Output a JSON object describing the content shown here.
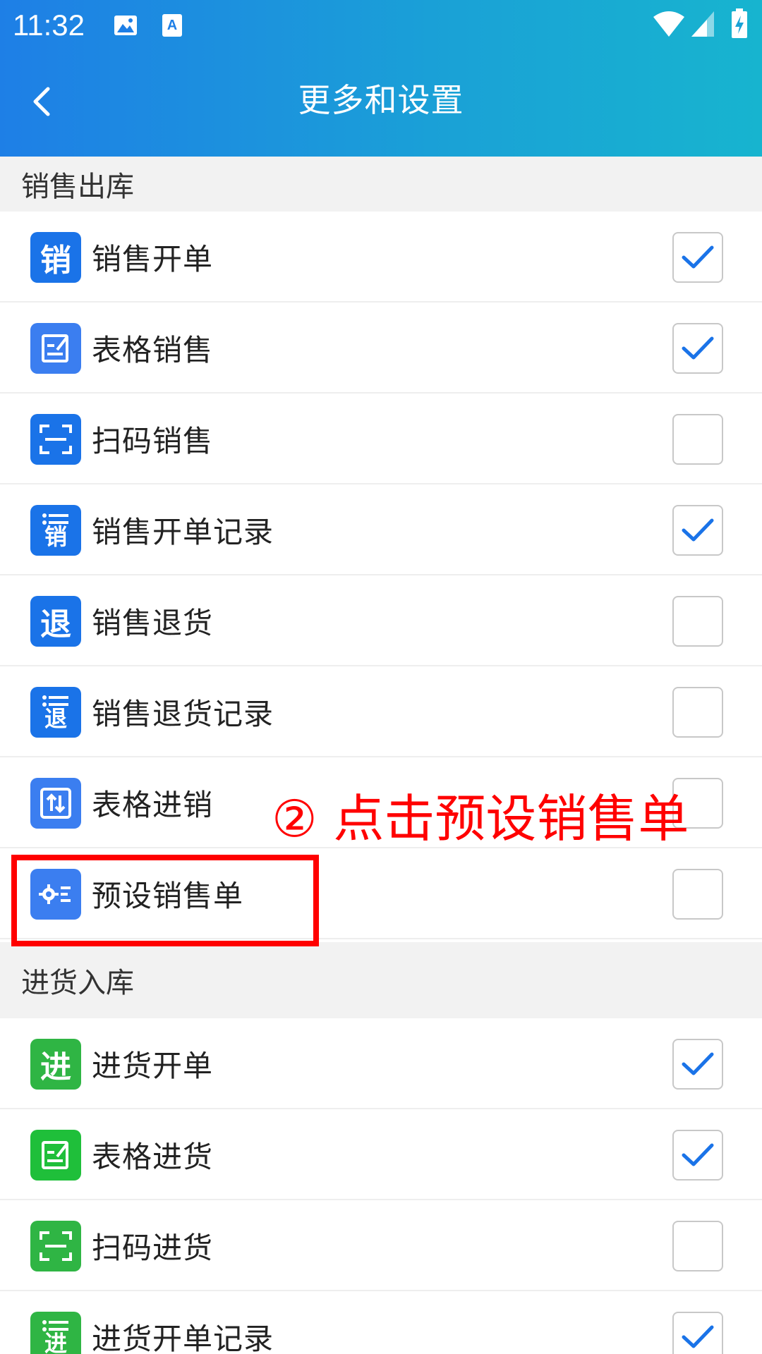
{
  "status_bar": {
    "time": "11:32",
    "icons": [
      "image-icon",
      "font-a-icon",
      "wifi-icon",
      "signal-icon",
      "battery-charging-icon"
    ]
  },
  "header": {
    "title": "更多和设置",
    "back_icon": "chevron-left-icon"
  },
  "colors": {
    "header_start": "#1e7fe6",
    "header_end": "#17b4cf",
    "sales_icon": "#1a73e8",
    "purchase_icon": "#2fb544",
    "check": "#1a73e8",
    "annotation": "#ff0000"
  },
  "sections": [
    {
      "title": "销售出库",
      "items": [
        {
          "label": "销售开单",
          "icon_text": "销",
          "icon": "sales-icon",
          "checked": true
        },
        {
          "label": "表格销售",
          "icon_text": "",
          "icon": "edit-form-icon",
          "checked": true
        },
        {
          "label": "扫码销售",
          "icon_text": "",
          "icon": "scan-icon",
          "checked": false
        },
        {
          "label": "销售开单记录",
          "icon_text": "销",
          "icon": "sales-record-icon",
          "checked": true
        },
        {
          "label": "销售退货",
          "icon_text": "退",
          "icon": "return-icon",
          "checked": false
        },
        {
          "label": "销售退货记录",
          "icon_text": "退",
          "icon": "return-record-icon",
          "checked": false
        },
        {
          "label": "表格进销",
          "icon_text": "",
          "icon": "exchange-icon",
          "checked": false
        },
        {
          "label": "预设销售单",
          "icon_text": "",
          "icon": "settings-list-icon",
          "checked": false
        }
      ]
    },
    {
      "title": "进货入库",
      "items": [
        {
          "label": "进货开单",
          "icon_text": "进",
          "icon": "purchase-icon",
          "checked": true
        },
        {
          "label": "表格进货",
          "icon_text": "",
          "icon": "edit-form-icon",
          "checked": true
        },
        {
          "label": "扫码进货",
          "icon_text": "",
          "icon": "scan-icon",
          "checked": false
        },
        {
          "label": "进货开单记录",
          "icon_text": "进",
          "icon": "purchase-record-icon",
          "checked": true
        }
      ]
    }
  ],
  "annotation": {
    "text": "② 点击预设销售单"
  }
}
